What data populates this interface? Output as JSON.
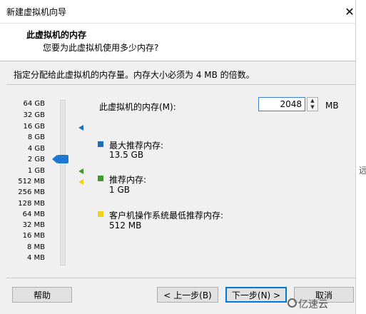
{
  "window": {
    "title": "新建虚拟机向导",
    "close_icon": "close-icon"
  },
  "header": {
    "title": "此虚拟机的内存",
    "subtitle": "您要为此虚拟机使用多少内存?"
  },
  "instruction": "指定分配给此虚拟机的内存量。内存大小必须为 4 MB 的倍数。",
  "scale": [
    "64 GB",
    "32 GB",
    "16 GB",
    "8 GB",
    "4 GB",
    "2 GB",
    "1 GB",
    "512 MB",
    "256 MB",
    "128 MB",
    "64 MB",
    "32 MB",
    "16 MB",
    "8 MB",
    "4 MB"
  ],
  "memory": {
    "label": "此虚拟机的内存(M):",
    "value": "2048",
    "unit": "MB"
  },
  "legend": [
    {
      "label": "最大推荐内存:",
      "value": "13.5 GB",
      "color": "#1f6fb7"
    },
    {
      "label": "推荐内存:",
      "value": "1 GB",
      "color": "#3f9a2f"
    },
    {
      "label": "客户机操作系统最低推荐内存:",
      "value": "512 MB",
      "color": "#f1d11a"
    }
  ],
  "buttons": {
    "help": "帮助",
    "back": "< 上一步(B)",
    "next": "下一步(N) >",
    "cancel": "取消"
  },
  "side_text": "远",
  "watermark": "亿速云"
}
